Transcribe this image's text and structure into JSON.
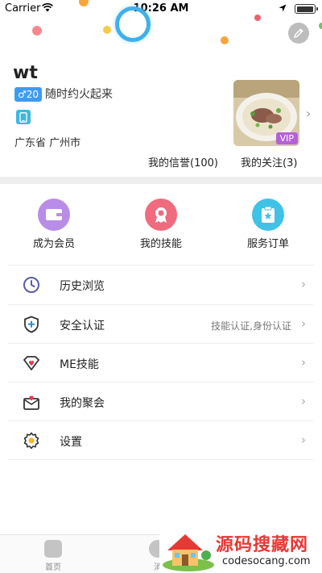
{
  "status_bar": {
    "carrier": "Carrier",
    "time": "10:26 AM"
  },
  "profile": {
    "username": "wt",
    "gender_age": "♂20",
    "slogan": "随时约火起来",
    "location": "广东省 广州市",
    "vip_label": "VIP",
    "credit": "我的信誉(100)",
    "follow": "我的关注(3)"
  },
  "quick_actions": [
    {
      "label": "成为会员",
      "color": "#b98ce8",
      "icon": "wallet-icon"
    },
    {
      "label": "我的技能",
      "color": "#f06b7e",
      "icon": "badge-icon"
    },
    {
      "label": "服务订单",
      "color": "#3fc2e6",
      "icon": "clipboard-star-icon"
    }
  ],
  "menu": [
    {
      "label": "历史浏览",
      "sub": "",
      "icon": "clock-icon"
    },
    {
      "label": "安全认证",
      "sub": "技能认证,身份认证",
      "icon": "shield-plus-icon"
    },
    {
      "label": "ME技能",
      "sub": "",
      "icon": "heart-diamond-icon"
    },
    {
      "label": "我的聚会",
      "sub": "",
      "icon": "envelope-heart-icon"
    },
    {
      "label": "设置",
      "sub": "",
      "icon": "gear-icon"
    }
  ],
  "tabbar": {
    "home": "首页",
    "messages": "消"
  },
  "watermark": {
    "title": "源码搜藏网",
    "url": "codesocang.com"
  },
  "colors": {
    "accent_blue": "#3fb0ea",
    "vip_purple": "#b561d8"
  }
}
